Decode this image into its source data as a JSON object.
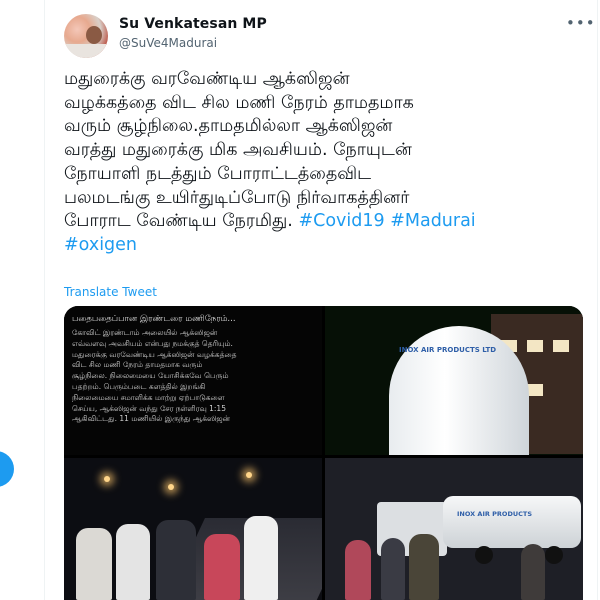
{
  "author": {
    "name": "Su Venkatesan MP",
    "handle": "@SuVe4Madurai"
  },
  "tweet": {
    "lines": [
      "மதுரைக்கு வரவேண்டிய ஆக்ஸிஜன்",
      "வழக்கத்தை விட சில மணி நேரம் தாமதமாக",
      "வரும் சூழ்நிலை.தாமதமில்லா ஆக்ஸிஜன்",
      "வரத்து மதுரைக்கு மிக அவசியம். நோயுடன்",
      "நோயாளி நடத்தும் போராட்டத்தைவிட",
      "பலமடங்கு உயிர்துடிப்போடு நிர்வாகத்தினர்"
    ],
    "last_line_text": "போராட வேண்டிய நேரமிது.",
    "hashtags": [
      "#Covid19",
      "#Madurai",
      "#oxigen"
    ]
  },
  "translate_label": "Translate Tweet",
  "menu_icon": "more-horizontal-icon",
  "media": {
    "note_title": "பதைபதைப்பான இரண்டரை மணிநேரம்...",
    "note_lines": [
      "கோவிட் இரண்டாம் அலையில் ஆக்ஸிஜன்",
      "எவ்வளவு அவசியம் என்பது நமக்குத் தெரியும்.",
      "மதுரைக்கு வரவேண்டிய ஆக்ஸிஜன் வழக்கத்தை",
      "விட சில மணி நேரம் தாமதமாக வரும்",
      "சூழ்நிலை. நிலைமையை யோசிக்கவே பெரும்",
      "பதற்றம். பெரும்படை களத்தில் இறங்கி",
      "நிலைமையை சமாளிக்க மாற்று ஏற்பாடுகளை",
      "செய்ய, ஆக்ஸிஜன் வந்து சேர நள்ளிரவு 1:15",
      "ஆகிவிட்டது. 11 மணியில் இருந்து ஆக்ஸிஜன்"
    ],
    "tank_label": "INOX AIR PRODUCTS LTD",
    "truck_label": "INOX AIR PRODUCTS"
  }
}
